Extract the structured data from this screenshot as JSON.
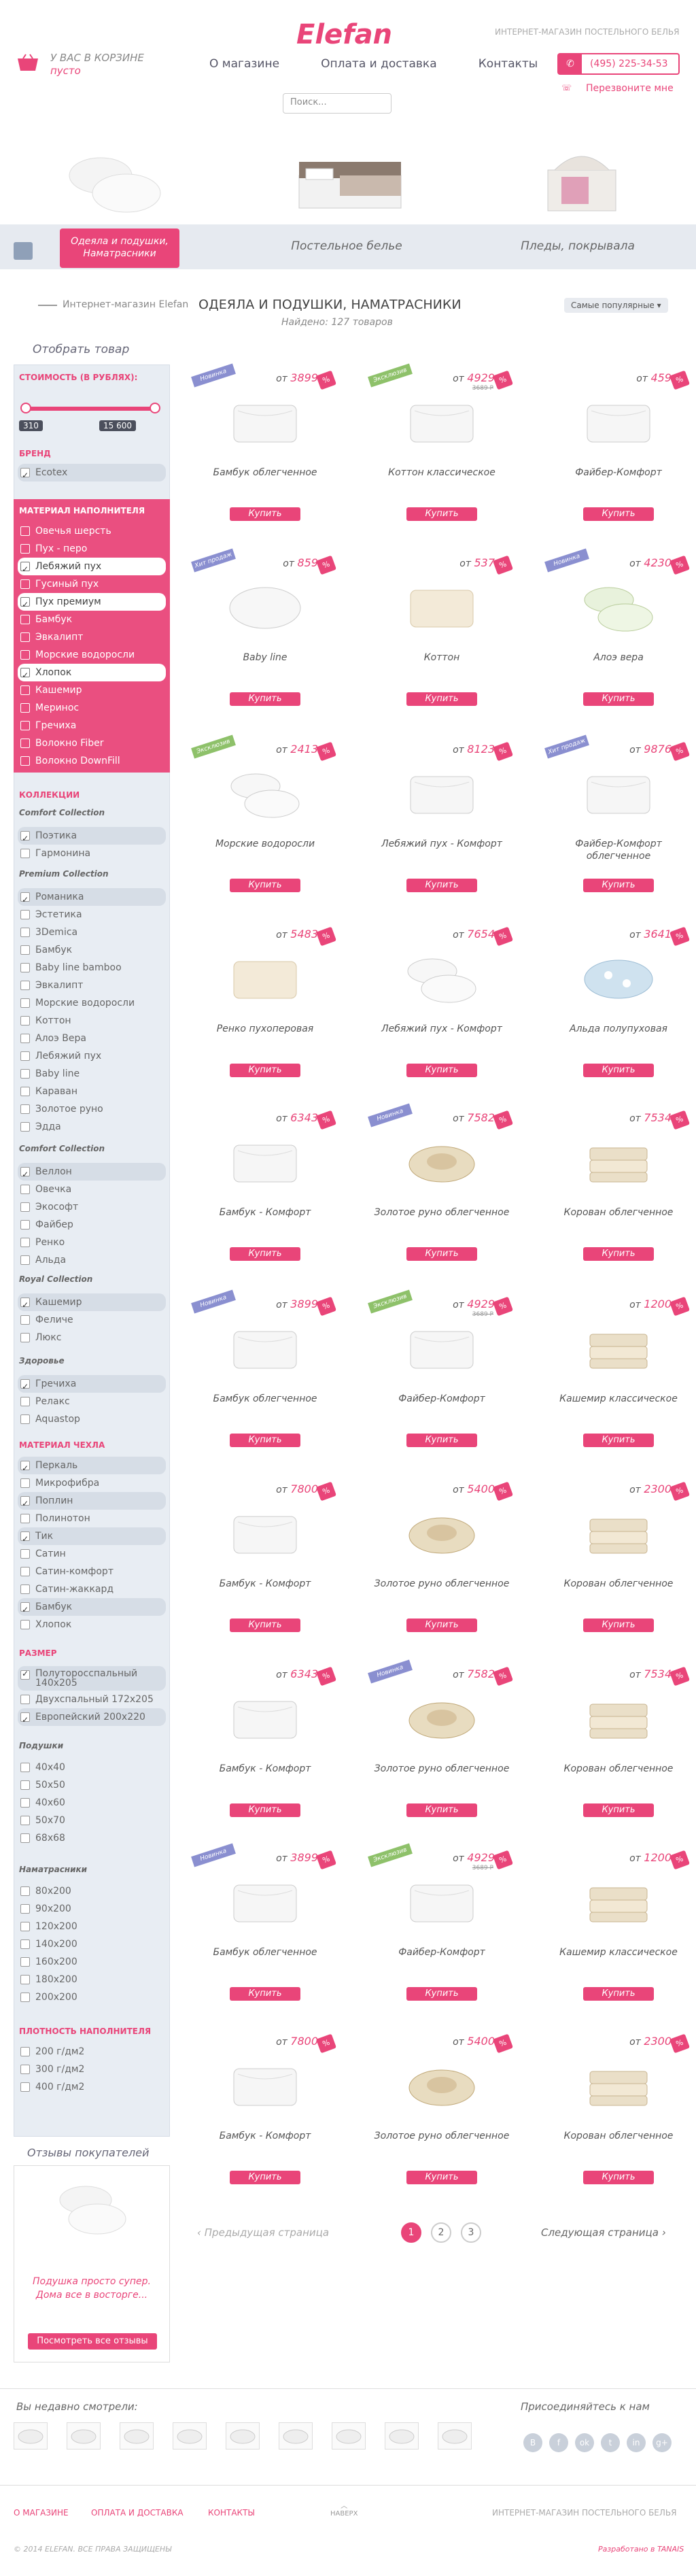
{
  "header": {
    "logo": "Elefan",
    "tagline": "ИНТЕРНЕТ-МАГАЗИН ПОСТЕЛЬНОГО БЕЛЬЯ",
    "cart_line1": "У ВАС В КОРЗИНЕ",
    "cart_line2": "пусто",
    "nav": [
      "О магазине",
      "Оплата и доставка",
      "Контакты"
    ],
    "phone": "(495) 225-34-53",
    "callback": "Перезвоните мне",
    "search_placeholder": "Поиск..."
  },
  "categories": [
    "Одеяла и подушки, Наматрасники",
    "Постельное белье",
    "Пледы, покрывала"
  ],
  "breadcrumb": {
    "root": "Интернет-магазин Elefan",
    "title": "ОДЕЯЛА И ПОДУШКИ, НАМАТРАСНИКИ",
    "found_label": "Найдено:",
    "found_count": "127 товаров",
    "sort": "Самые популярные"
  },
  "sidebar": {
    "title": "Отобрать товар",
    "price_label": "СТОИМОСТЬ (В РУБЛЯХ):",
    "price_min": "310",
    "price_max": "15 600",
    "brand_label": "БРЕНД",
    "brand": [
      {
        "label": "Ecotex",
        "on": true
      }
    ],
    "material_label": "МАТЕРИАЛ НАПОЛНИТЕЛЯ",
    "materials": [
      {
        "label": "Овечья шерсть",
        "on": false
      },
      {
        "label": "Пух - перо",
        "on": false
      },
      {
        "label": "Лебяжий пух",
        "on": true
      },
      {
        "label": "Гусиный пух",
        "on": false
      },
      {
        "label": "Пух премиум",
        "on": true
      },
      {
        "label": "Бамбук",
        "on": false
      },
      {
        "label": "Эвкалипт",
        "on": false
      },
      {
        "label": "Морские водоросли",
        "on": false
      },
      {
        "label": "Хлопок",
        "on": true
      },
      {
        "label": "Кашемир",
        "on": false
      },
      {
        "label": "Меринос",
        "on": false
      },
      {
        "label": "Гречиха",
        "on": false
      },
      {
        "label": "Волокно Fiber",
        "on": false
      },
      {
        "label": "Волокно DownFill",
        "on": false
      }
    ],
    "collections_label": "КОЛЛЕКЦИИ",
    "comfort_label": "Comfort Collection",
    "comfort1": [
      {
        "label": "Поэтика",
        "on": true
      },
      {
        "label": "Гармонина",
        "on": false
      }
    ],
    "premium_label": "Premium Collection",
    "premium": [
      {
        "label": "Романика",
        "on": true
      },
      {
        "label": "Эстетика",
        "on": false
      },
      {
        "label": "3Demica",
        "on": false
      },
      {
        "label": "Бамбук",
        "on": false
      },
      {
        "label": "Baby line bamboo",
        "on": false
      },
      {
        "label": "Эвкалипт",
        "on": false
      },
      {
        "label": "Морские водоросли",
        "on": false
      },
      {
        "label": "Коттон",
        "on": false
      },
      {
        "label": "Алоэ Вера",
        "on": false
      },
      {
        "label": "Лебяжий пух",
        "on": false
      },
      {
        "label": "Baby line",
        "on": false
      },
      {
        "label": "Караван",
        "on": false
      },
      {
        "label": "Золотое руно",
        "on": false
      },
      {
        "label": "Эдда",
        "on": false
      }
    ],
    "comfort2_label": "Comfort Collection",
    "comfort2": [
      {
        "label": "Веллон",
        "on": true
      },
      {
        "label": "Овечка",
        "on": false
      },
      {
        "label": "Экософт",
        "on": false
      },
      {
        "label": "Файбер",
        "on": false
      },
      {
        "label": "Ренко",
        "on": false
      },
      {
        "label": "Альда",
        "on": false
      }
    ],
    "royal_label": "Royal Collection",
    "royal": [
      {
        "label": "Кашемир",
        "on": true
      },
      {
        "label": "Феличе",
        "on": false
      },
      {
        "label": "Люкс",
        "on": false
      }
    ],
    "health_label": "Здоровье",
    "health": [
      {
        "label": "Гречиха",
        "on": true
      },
      {
        "label": "Релакс",
        "on": false
      },
      {
        "label": "Aquastop",
        "on": false
      }
    ],
    "cover_label": "МАТЕРИАЛ ЧЕХЛА",
    "cover": [
      {
        "label": "Перкаль",
        "on": true
      },
      {
        "label": "Микрофибра",
        "on": false
      },
      {
        "label": "Поплин",
        "on": true
      },
      {
        "label": "Полинотон",
        "on": false
      },
      {
        "label": "Тик",
        "on": true
      },
      {
        "label": "Сатин",
        "on": false
      },
      {
        "label": "Сатин-комфорт",
        "on": false
      },
      {
        "label": "Сатин-жаккард",
        "on": false
      },
      {
        "label": "Бамбук",
        "on": true
      },
      {
        "label": "Хлопок",
        "on": false
      }
    ],
    "size_label": "РАЗМЕР",
    "size": [
      {
        "label": "Полуторосспальный 140х205",
        "on": true
      },
      {
        "label": "Двухспальный 172х205",
        "on": false
      },
      {
        "label": "Европейский 200х220",
        "on": true
      }
    ],
    "pillows_label": "Подушки",
    "pillows": [
      {
        "label": "40х40",
        "on": false
      },
      {
        "label": "50х50",
        "on": false
      },
      {
        "label": "40х60",
        "on": false
      },
      {
        "label": "50х70",
        "on": false
      },
      {
        "label": "68х68",
        "on": false
      }
    ],
    "mattress_label": "Наматрасники",
    "mattress": [
      {
        "label": "80х200",
        "on": false
      },
      {
        "label": "90х200",
        "on": false
      },
      {
        "label": "120х200",
        "on": false
      },
      {
        "label": "140х200",
        "on": false
      },
      {
        "label": "160х200",
        "on": false
      },
      {
        "label": "180х200",
        "on": false
      },
      {
        "label": "200х200",
        "on": false
      }
    ],
    "density_label": "ПЛОТНОСТЬ НАПОЛНИТЕЛЯ",
    "density": [
      {
        "label": "200 г/дм2",
        "on": false
      },
      {
        "label": "300 г/дм2",
        "on": false
      },
      {
        "label": "400 г/дм2",
        "on": false
      }
    ]
  },
  "reviews": {
    "title": "Отзывы покупателей",
    "quote": "Подушка просто супер. Дома все в восторге...",
    "button": "Посмотреть все отзывы"
  },
  "ui": {
    "from": "от",
    "buy": "Купить",
    "discount": "%"
  },
  "products": [
    {
      "price": "3899",
      "name": "Бамбук облегченное",
      "ribbon": "Новинка",
      "rc": "#8a8fd0",
      "img": "duvet"
    },
    {
      "price": "4929",
      "name": "Коттон классическое",
      "ribbon": "Эксклюзив",
      "rc": "#8ec16a",
      "img": "duvet",
      "small": "3689 Р"
    },
    {
      "price": "459",
      "name": "Файбер-Комфорт",
      "ribbon": "",
      "rc": "",
      "img": "duvet"
    },
    {
      "price": "859",
      "name": "Baby line",
      "ribbon": "Хит продаж",
      "rc": "#8a8fd0",
      "img": "pillow"
    },
    {
      "price": "537",
      "name": "Коттон",
      "ribbon": "",
      "rc": "",
      "img": "cream"
    },
    {
      "price": "4230",
      "name": "Алоэ вера",
      "ribbon": "Новинка",
      "rc": "#8a8fd0",
      "img": "green"
    },
    {
      "price": "2413",
      "name": "Морские водоросли",
      "ribbon": "Эксклюзив",
      "rc": "#8ec16a",
      "img": "pillows"
    },
    {
      "price": "8123",
      "name": "Лебяжий пух - Комфорт",
      "ribbon": "",
      "rc": "",
      "img": "duvet"
    },
    {
      "price": "9876",
      "name": "Файбер-Комфорт облегченное",
      "ribbon": "Хит продаж",
      "rc": "#8a8fd0",
      "img": "duvet"
    },
    {
      "price": "5483",
      "name": "Ренко пухоперовая",
      "ribbon": "",
      "rc": "",
      "img": "cream"
    },
    {
      "price": "7654",
      "name": "Лебяжий пух - Комфорт",
      "ribbon": "",
      "rc": "",
      "img": "pillows"
    },
    {
      "price": "3641",
      "name": "Альда полупуховая",
      "ribbon": "",
      "rc": "",
      "img": "blue"
    },
    {
      "price": "6343",
      "name": "Бамбук - Комфорт",
      "ribbon": "",
      "rc": "",
      "img": "duvet"
    },
    {
      "price": "7582",
      "name": "Золотое руно облегченное",
      "ribbon": "Новинка",
      "rc": "#8a8fd0",
      "img": "roll"
    },
    {
      "price": "7534",
      "name": "Корован облегченное",
      "ribbon": "",
      "rc": "",
      "img": "stack"
    },
    {
      "price": "3899",
      "name": "Бамбук облегченное",
      "ribbon": "Новинка",
      "rc": "#8a8fd0",
      "img": "duvet"
    },
    {
      "price": "4929",
      "name": "Файбер-Комфорт",
      "ribbon": "Эксклюзив",
      "rc": "#8ec16a",
      "img": "duvet",
      "small": "3689 Р"
    },
    {
      "price": "1200",
      "name": "Кашемир классическое",
      "ribbon": "",
      "rc": "",
      "img": "stack"
    },
    {
      "price": "7800",
      "name": "Бамбук - Комфорт",
      "ribbon": "",
      "rc": "",
      "img": "duvet"
    },
    {
      "price": "5400",
      "name": "Золотое руно облегченное",
      "ribbon": "",
      "rc": "",
      "img": "roll"
    },
    {
      "price": "2300",
      "name": "Корован облегченное",
      "ribbon": "",
      "rc": "",
      "img": "stack"
    },
    {
      "price": "6343",
      "name": "Бамбук - Комфорт",
      "ribbon": "",
      "rc": "",
      "img": "duvet"
    },
    {
      "price": "7582",
      "name": "Золотое руно облегченное",
      "ribbon": "Новинка",
      "rc": "#8a8fd0",
      "img": "roll"
    },
    {
      "price": "7534",
      "name": "Корован облегченное",
      "ribbon": "",
      "rc": "",
      "img": "stack"
    },
    {
      "price": "3899",
      "name": "Бамбук облегченное",
      "ribbon": "Новинка",
      "rc": "#8a8fd0",
      "img": "duvet"
    },
    {
      "price": "4929",
      "name": "Файбер-Комфорт",
      "ribbon": "Эксклюзив",
      "rc": "#8ec16a",
      "img": "duvet",
      "small": "3689 Р"
    },
    {
      "price": "1200",
      "name": "Кашемир классическое",
      "ribbon": "",
      "rc": "",
      "img": "stack"
    },
    {
      "price": "7800",
      "name": "Бамбук - Комфорт",
      "ribbon": "",
      "rc": "",
      "img": "duvet"
    },
    {
      "price": "5400",
      "name": "Золотое руно облегченное",
      "ribbon": "",
      "rc": "",
      "img": "roll"
    },
    {
      "price": "2300",
      "name": "Корован облегченное",
      "ribbon": "",
      "rc": "",
      "img": "stack"
    }
  ],
  "pager": {
    "prev": "Предыдущая страница",
    "next": "Следующая страница",
    "pages": [
      "1",
      "2",
      "3"
    ]
  },
  "footer": {
    "recent": "Вы недавно смотрели:",
    "social": "Присоединяйтесь к нам",
    "social_icons": [
      "B",
      "f",
      "ok",
      "t",
      "in",
      "g+"
    ],
    "links": [
      "О МАГАЗИНЕ",
      "ОПЛАТА И ДОСТАВКА",
      "КОНТАКТЫ"
    ],
    "tagline": "ИНТЕРНЕТ-МАГАЗИН ПОСТЕЛЬНОГО БЕЛЬЯ",
    "copyright": "© 2014 ELEFAN. ВСЕ ПРАВА ЗАЩИЩЕНЫ",
    "credits": "Разработано в TANAIS",
    "up": "НАВЕРХ"
  },
  "colors": {
    "accent": "#e94579",
    "ribbon_new": "#8a8fd0",
    "ribbon_excl": "#8ec16a"
  }
}
